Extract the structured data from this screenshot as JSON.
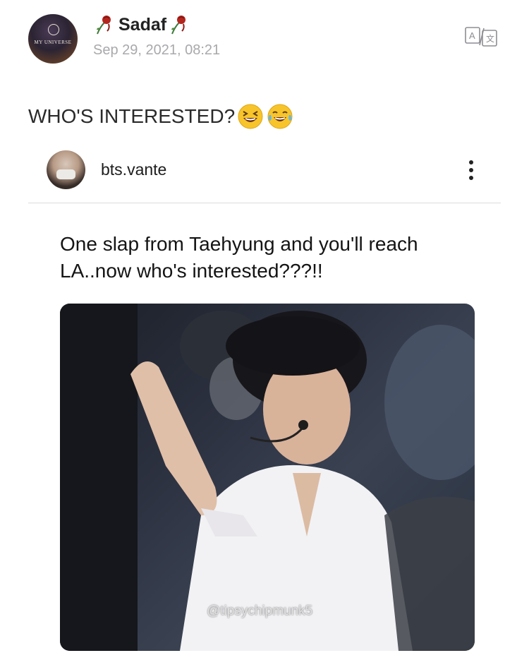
{
  "post": {
    "author": "Sadaf",
    "timestamp": "Sep 29, 2021, 08:21",
    "avatar_text": "MY UNIVERSE",
    "text": "WHO'S INTERESTED?"
  },
  "embed": {
    "username": "bts.vante",
    "caption": "One slap from Taehyung and you'll reach LA..now who's interested???!!",
    "watermark": "@tipsychipmunk5"
  },
  "icons": {
    "name_decoration": "wilted-rose-icon",
    "translate": "translate-icon",
    "more": "vertical-ellipsis-icon",
    "emojis": [
      "laughing-squint-emoji",
      "tears-of-joy-emoji"
    ]
  },
  "colors": {
    "timestamp": "#a9a9ad",
    "text": "#2a2a2a",
    "divider": "#dcdcdc",
    "icon": "#8e8e93"
  }
}
